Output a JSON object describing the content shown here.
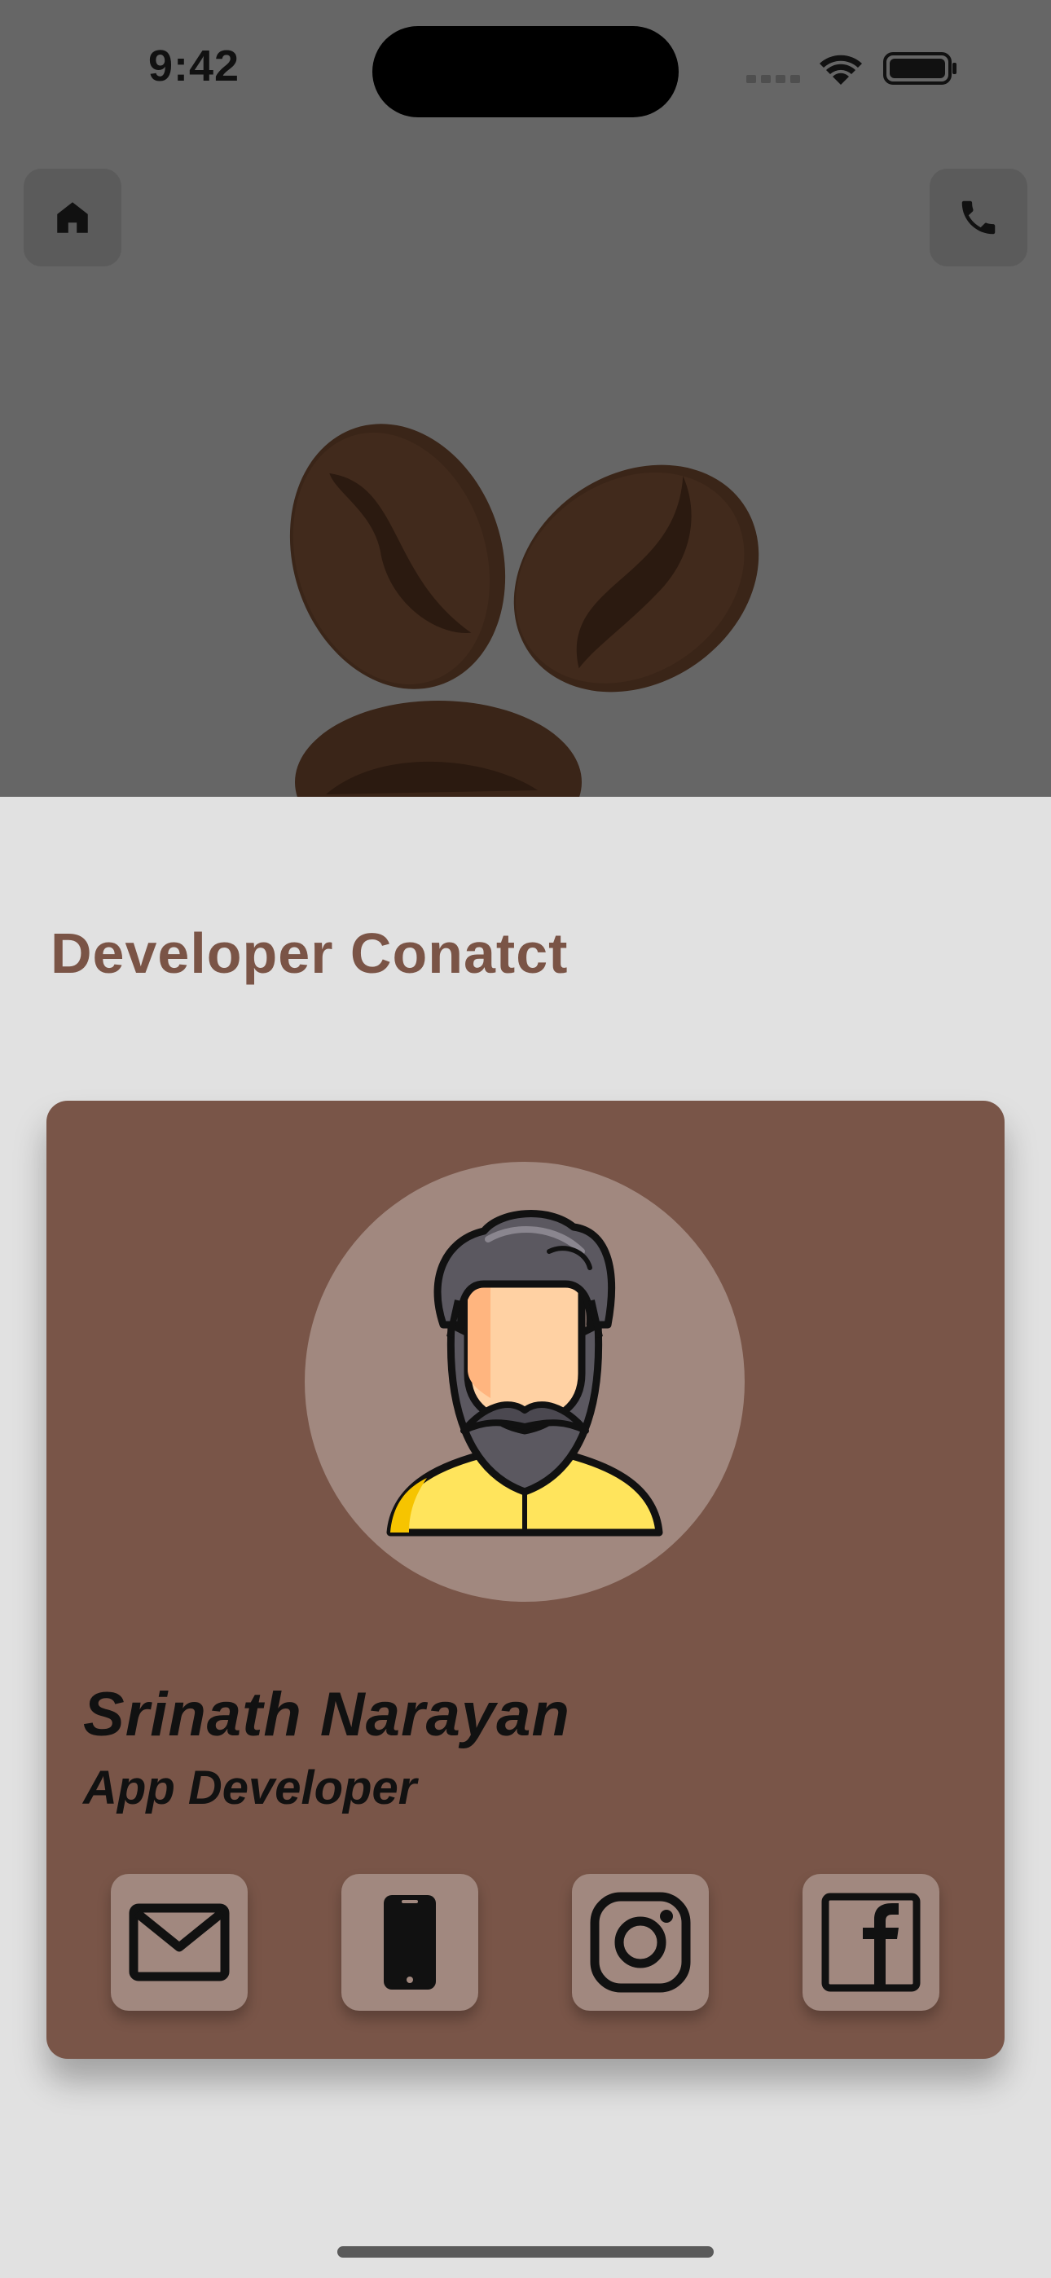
{
  "status_bar": {
    "time": "9:42"
  },
  "header": {
    "home_icon": "home-icon",
    "phone_icon": "phone-icon"
  },
  "section": {
    "title": "Developer Conatct"
  },
  "developer": {
    "name": "Srinath Narayan",
    "role": "App Developer"
  },
  "contacts": [
    {
      "name": "email",
      "icon": "mail-icon"
    },
    {
      "name": "phone",
      "icon": "mobile-phone-icon"
    },
    {
      "name": "instagram",
      "icon": "instagram-icon"
    },
    {
      "name": "facebook",
      "icon": "facebook-icon"
    }
  ],
  "colors": {
    "hero_bg": "#666666",
    "page_bg": "#e1e1e1",
    "card_bg": "#795548",
    "accent_light": "#a1887f",
    "title_color": "#7a5446"
  }
}
